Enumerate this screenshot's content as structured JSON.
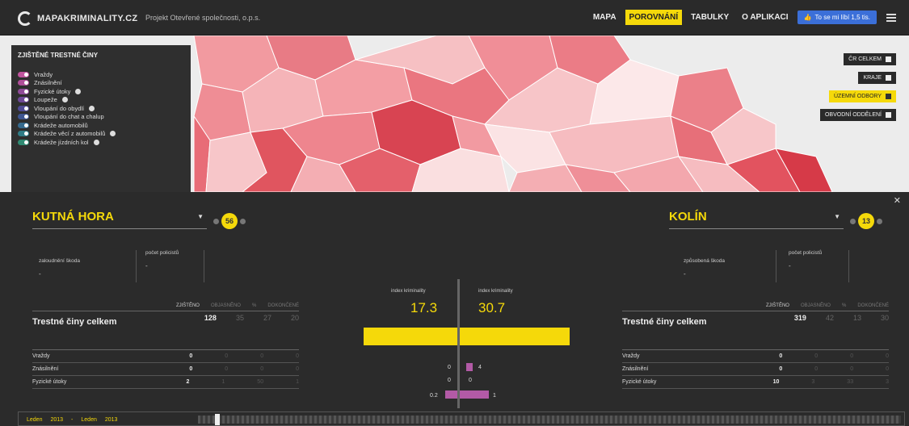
{
  "header": {
    "logo_text": "MAPAKRIMINALITY.CZ",
    "project": "Projekt Otevřené společnosti, o.p.s.",
    "nav": [
      {
        "label": "MAPA",
        "active": false
      },
      {
        "label": "POROVNÁNÍ",
        "active": true
      },
      {
        "label": "TABULKY",
        "active": false
      },
      {
        "label": "O APLIKACI",
        "active": false
      }
    ],
    "like_label": "To se mi líbí 1,5 tis."
  },
  "legend": {
    "title": "ZJIŠTĚNÉ TRESTNÉ ČINY",
    "items": [
      {
        "label": "Vraždy",
        "color": "#c0549e",
        "help": false
      },
      {
        "label": "Znásilnění",
        "color": "#b04e9a",
        "help": false
      },
      {
        "label": "Fyzické útoky",
        "color": "#8f4a98",
        "help": true
      },
      {
        "label": "Loupeže",
        "color": "#6d4896",
        "help": true
      },
      {
        "label": "Vloupání do obydlí",
        "color": "#4f4a94",
        "help": true
      },
      {
        "label": "Vloupání do chat a chalup",
        "color": "#3d5592",
        "help": false
      },
      {
        "label": "Krádeže automobilů",
        "color": "#356a8e",
        "help": false
      },
      {
        "label": "Krádeže věcí z automobilů",
        "color": "#2f7c86",
        "help": true
      },
      {
        "label": "Krádeže jízdních kol",
        "color": "#2f8a72",
        "help": true
      }
    ]
  },
  "map_buttons": [
    {
      "label": "ČR CELKEM",
      "active": false
    },
    {
      "label": "KRAJE",
      "active": false
    },
    {
      "label": "ÚZEMNÍ ODBORY",
      "active": true
    },
    {
      "label": "OBVODNÍ ODDĚLENÍ",
      "active": false
    }
  ],
  "compare": {
    "left": {
      "district": "KUTNÁ HORA",
      "rank": "56",
      "info_labels": [
        "zaloudnění škoda",
        "počet policistů"
      ],
      "info_values": [
        "-",
        "-"
      ],
      "index_label": "index kriminality",
      "index_value": "17.3",
      "table_headers": [
        "ZJIŠTĚNO",
        "OBJASNĚNO",
        "%",
        "DOKONČENÉ"
      ],
      "total_label": "Trestné činy celkem",
      "total_values": [
        "128",
        "35",
        "27",
        "20"
      ],
      "rows": [
        {
          "label": "Vraždy",
          "values": [
            "0",
            "0",
            "0",
            "0"
          ]
        },
        {
          "label": "Znásilnění",
          "values": [
            "0",
            "0",
            "0",
            "0"
          ]
        },
        {
          "label": "Fyzické útoky",
          "values": [
            "2",
            "1",
            "50",
            "1"
          ]
        }
      ]
    },
    "right": {
      "district": "KOLÍN",
      "rank": "13",
      "info_labels": [
        "způsobená škoda",
        "počet policistů"
      ],
      "info_values": [
        "-",
        "-"
      ],
      "index_label": "index kriminality",
      "index_value": "30.7",
      "table_headers": [
        "ZJIŠTĚNO",
        "OBJASNĚNO",
        "%",
        "DOKONČENÉ"
      ],
      "total_label": "Trestné činy celkem",
      "total_values": [
        "319",
        "42",
        "13",
        "30"
      ],
      "rows": [
        {
          "label": "Vraždy",
          "values": [
            "0",
            "0",
            "0",
            "0"
          ]
        },
        {
          "label": "Znásilnění",
          "values": [
            "0",
            "0",
            "0",
            "0"
          ]
        },
        {
          "label": "Fyzické útoky",
          "values": [
            "10",
            "3",
            "33",
            "3"
          ]
        }
      ]
    },
    "mini_bars": {
      "left_labels": [
        "0",
        "0",
        "0.2"
      ],
      "right_labels": [
        "4",
        "0",
        "1"
      ]
    }
  },
  "timeline": {
    "from_month": "Leden",
    "from_year": "2013",
    "to_month": "Leden",
    "to_year": "2013",
    "separator": "-"
  }
}
